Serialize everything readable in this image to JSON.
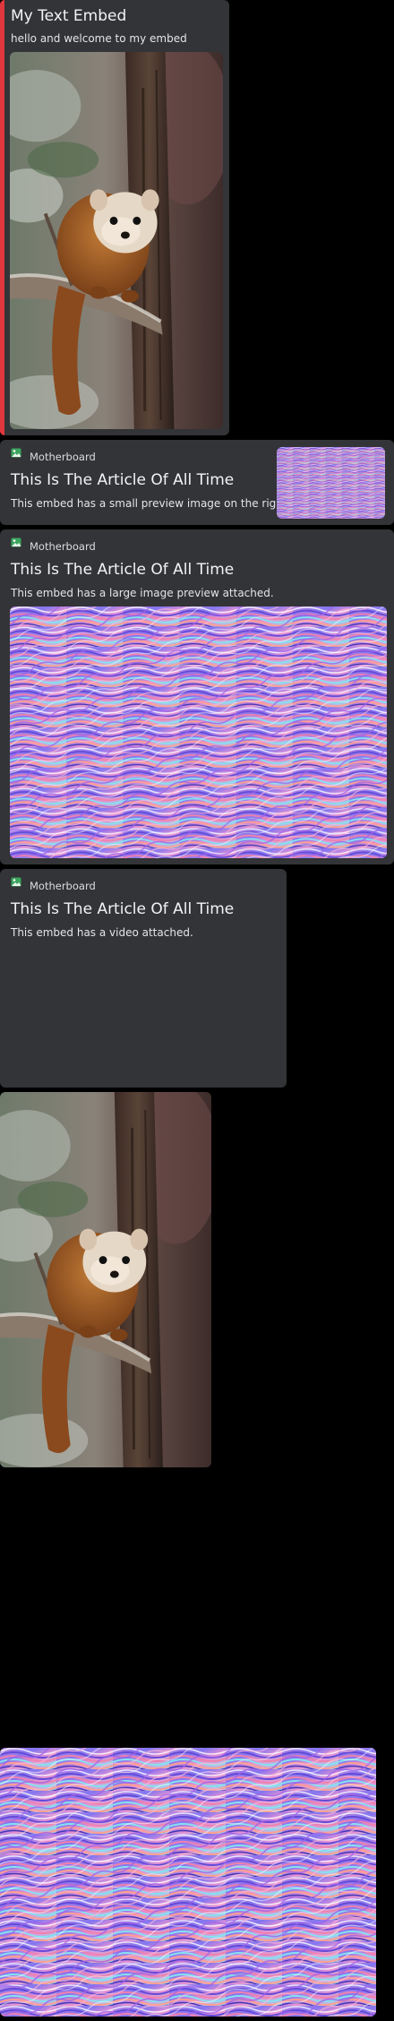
{
  "text_embed": {
    "title": "My Text Embed",
    "description": "hello and welcome to my embed",
    "accent_color": "#e0383e",
    "image": "pine-marten-photo"
  },
  "embed_small": {
    "provider": "Motherboard",
    "provider_icon": "image-icon",
    "title": "This Is The Article Of All Time",
    "description": "This embed has a small preview image on the right...",
    "thumbnail": "abstract-wave-art"
  },
  "embed_large": {
    "provider": "Motherboard",
    "provider_icon": "image-icon",
    "title": "This Is The Article Of All Time",
    "description": "This embed has a large image preview attached.",
    "image": "abstract-wave-art"
  },
  "embed_video": {
    "provider": "Motherboard",
    "provider_icon": "image-icon",
    "title": "This Is The Article Of All Time",
    "description": "This embed has a video attached."
  },
  "attachments": [
    {
      "image": "pine-marten-photo"
    },
    {
      "image": "abstract-wave-art"
    }
  ],
  "colors": {
    "background": "#000000",
    "embed_bg": "#333437",
    "favicon_green": "#3ba55d"
  }
}
